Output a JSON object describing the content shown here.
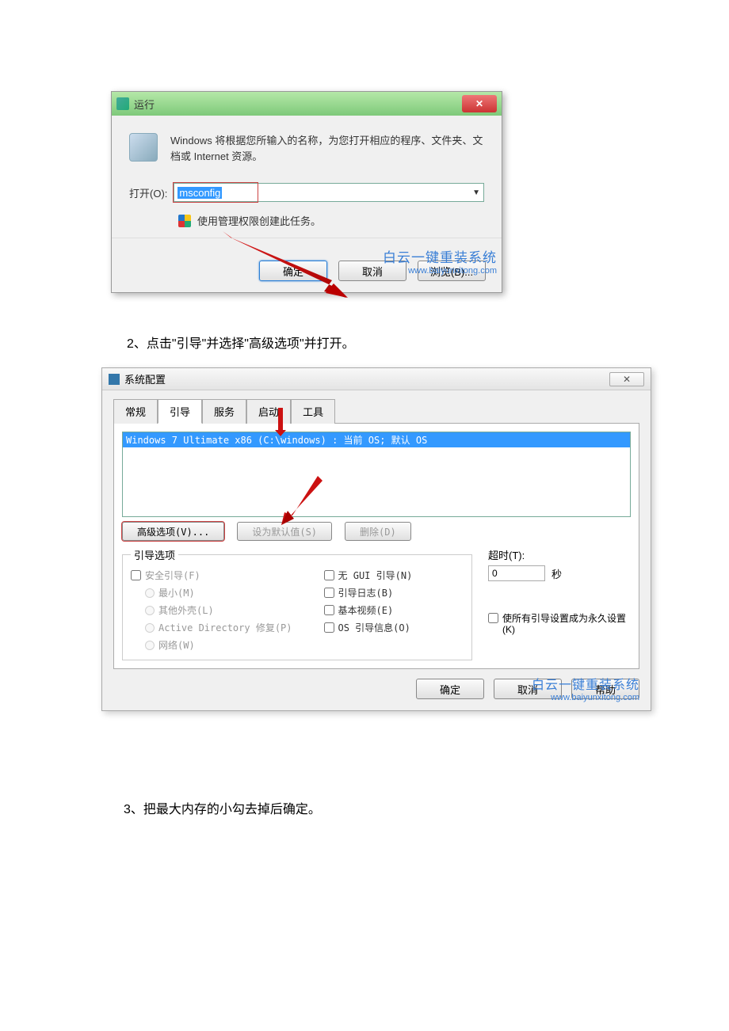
{
  "run_dialog": {
    "title": "运行",
    "close_glyph": "✕",
    "description": "Windows 将根据您所输入的名称，为您打开相应的程序、文件夹、文档或 Internet 资源。",
    "open_label": "打开(O):",
    "input_value": "msconfig",
    "admin_text": "使用管理权限创建此任务。",
    "ok": "确定",
    "cancel": "取消",
    "browse": "浏览(B)..."
  },
  "watermark": {
    "main": "白云一键重装系统",
    "sub": "www.baiyunxitong.com"
  },
  "instruction_2": "2、点击\"引导\"并选择\"高级选项\"并打开。",
  "sysconfig": {
    "title": "系统配置",
    "close_glyph": "✕",
    "tabs": {
      "general": "常规",
      "boot": "引导",
      "services": "服务",
      "startup": "启动",
      "tools": "工具"
    },
    "os_entry": "Windows 7 Ultimate x86 (C:\\windows) : 当前 OS; 默认 OS",
    "advanced_btn": "高级选项(V)...",
    "setdefault_btn": "设为默认值(S)",
    "delete_btn": "删除(D)",
    "legend": "引导选项",
    "col1": {
      "safe": "安全引导(F)",
      "min": "最小(M)",
      "shell": "其他外壳(L)",
      "adrepair": "Active Directory 修复(P)",
      "network": "网络(W)"
    },
    "col2": {
      "nogui": "无 GUI 引导(N)",
      "bootlog": "引导日志(B)",
      "basevideo": "基本视频(E)",
      "osinfo": "OS 引导信息(O)"
    },
    "timeout_label": "超时(T):",
    "timeout_value": "0",
    "timeout_unit": "秒",
    "permanent": "使所有引导设置成为永久设置(K)",
    "ok": "确定",
    "cancel": "取消",
    "help": "帮助"
  },
  "instruction_3": "3、把最大内存的小勾去掉后确定。"
}
